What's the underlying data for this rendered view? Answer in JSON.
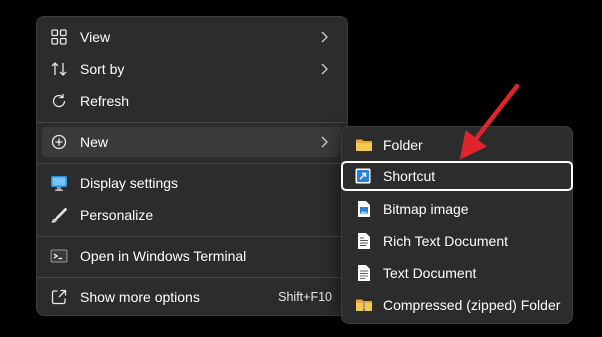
{
  "context_menu": {
    "items": [
      {
        "label": "View",
        "icon": "grid-icon",
        "submenu": true
      },
      {
        "label": "Sort by",
        "icon": "sort-icon",
        "submenu": true
      },
      {
        "label": "Refresh",
        "icon": "refresh-icon"
      },
      {
        "label": "New",
        "icon": "plus-circle-icon",
        "submenu": true,
        "highlighted": true
      },
      {
        "label": "Display settings",
        "icon": "monitor-icon"
      },
      {
        "label": "Personalize",
        "icon": "brush-icon"
      },
      {
        "label": "Open in Windows Terminal",
        "icon": "terminal-icon"
      },
      {
        "label": "Show more options",
        "icon": "external-icon",
        "shortcut": "Shift+F10"
      }
    ]
  },
  "new_submenu": {
    "items": [
      {
        "label": "Folder",
        "icon": "folder-icon"
      },
      {
        "label": "Shortcut",
        "icon": "shortcut-icon",
        "selected": true
      },
      {
        "label": "Bitmap image",
        "icon": "bitmap-icon"
      },
      {
        "label": "Rich Text Document",
        "icon": "rtf-document-icon"
      },
      {
        "label": "Text Document",
        "icon": "text-document-icon"
      },
      {
        "label": "Compressed (zipped) Folder",
        "icon": "zip-folder-icon"
      }
    ]
  },
  "colors": {
    "menu_bg": "#2c2c2c",
    "highlight": "#3a3a3a",
    "accent_arrow": "#e0242c",
    "folder": "#f4c84a",
    "shortcut_bg": "#2b7fd6"
  }
}
